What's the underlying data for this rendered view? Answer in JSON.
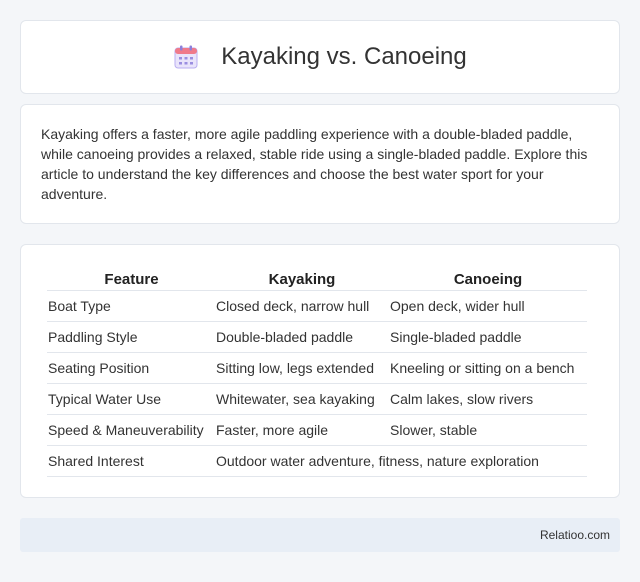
{
  "header": {
    "title": "Kayaking vs. Canoeing",
    "icon": "calendar-icon"
  },
  "intro": {
    "text": "Kayaking offers a faster, more agile paddling experience with a double-bladed paddle, while canoeing provides a relaxed, stable ride using a single-bladed paddle. Explore this article to understand the key differences and choose the best water sport for your adventure."
  },
  "table": {
    "headers": [
      "Feature",
      "Kayaking",
      "Canoeing"
    ],
    "rows": [
      [
        "Boat Type",
        "Closed deck, narrow hull",
        "Open deck, wider hull"
      ],
      [
        "Paddling Style",
        "Double-bladed paddle",
        "Single-bladed paddle"
      ],
      [
        "Seating Position",
        "Sitting low, legs extended",
        "Kneeling or sitting on a bench"
      ],
      [
        "Typical Water Use",
        "Whitewater, sea kayaking",
        "Calm lakes, slow rivers"
      ],
      [
        "Speed & Maneuverability",
        "Faster, more agile",
        "Slower, stable"
      ]
    ],
    "shared": {
      "label": "Shared Interest",
      "value": "Outdoor water adventure, fitness, nature exploration"
    }
  },
  "footer": {
    "brand": "Relatioo.com"
  }
}
